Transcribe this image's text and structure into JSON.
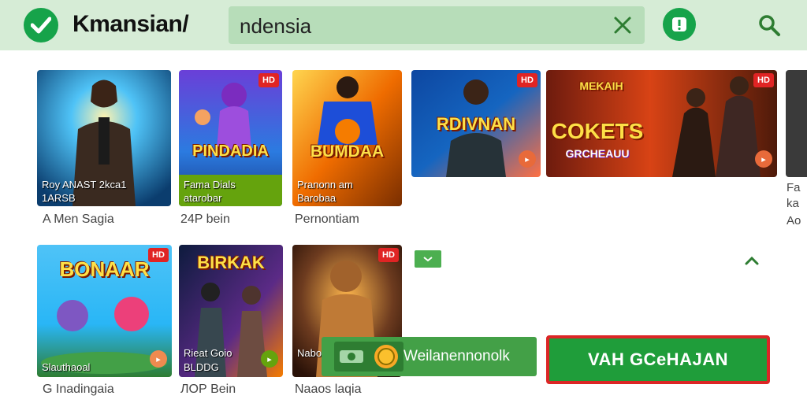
{
  "header": {
    "brand": "Kmansian/",
    "search_value": "ndensia"
  },
  "row1": [
    {
      "overlay1": "Roy ANAST 2kca1",
      "overlay2": "1ARSB",
      "caption": "A Men Sagia"
    },
    {
      "title": "PINDADIA",
      "overlay1": "Fama Dials",
      "overlay2": "atarobar",
      "caption": "24P bein",
      "badge": "HD"
    },
    {
      "title": "BUMDAA",
      "overlay1": "Pranonn am",
      "overlay2": "Barobaa",
      "caption": "Pernontiam"
    },
    {
      "title": "RDIVNAN",
      "badge": "HD"
    },
    {
      "title": "COKETS",
      "subtitle": "GRCHEAUU",
      "sign": "MEKAIH",
      "badge": "HD"
    }
  ],
  "row2": [
    {
      "title": "BONAAR",
      "overlay1": "Slauthaoal",
      "caption": "G Inadingaia",
      "badge": "HD"
    },
    {
      "title": "BIRKAK",
      "overlay1": "Rieat Goio",
      "overlay2": "BLDDG",
      "caption": "ЛОР Bein"
    },
    {
      "overlay1": "Nabono",
      "caption": "Naaos laqia",
      "badge": "HD"
    }
  ],
  "edge_captions": [
    "Fa",
    "ka",
    "Ao"
  ],
  "promo": {
    "label": "Weilanennonolk"
  },
  "cta": {
    "label": "VAH GCeHAJAN"
  },
  "colors": {
    "accent": "#16a34a",
    "header_bg": "#d6ecd6",
    "cta_border": "#dc2626"
  }
}
